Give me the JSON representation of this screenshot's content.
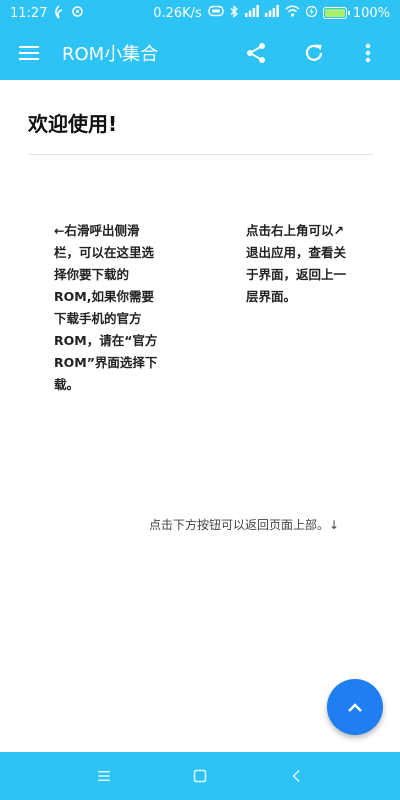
{
  "status_bar": {
    "time": "11:27",
    "network_speed": "0.26K/s",
    "battery_percent": "100%",
    "icons": [
      "app-notification-icon",
      "sync-icon",
      "messages-icon",
      "bluetooth-icon",
      "signal-icon",
      "signal-icon",
      "wifi-icon",
      "charging-icon",
      "battery-icon"
    ]
  },
  "app_bar": {
    "title": "ROM小集合",
    "icons": [
      "menu-icon",
      "share-icon",
      "refresh-icon",
      "more-vert-icon"
    ]
  },
  "content": {
    "welcome": "欢迎使用!",
    "tip_left": "←右滑呼出侧滑栏，可以在这里选择你要下载的ROM,如果你需要下载手机的官方ROM，请在“官方ROM”界面选择下载。",
    "tip_right": "点击右上角可以↗退出应用，查看关于界面，返回上一层界面。",
    "tip_bottom": "点击下方按钮可以返回页面上部。↓"
  },
  "fab": {
    "icon": "chevron-up-icon"
  },
  "nav_bar": {
    "icons": [
      "recent-apps-icon",
      "home-icon",
      "back-icon"
    ]
  },
  "colors": {
    "primary": "#2ec3f5",
    "fab": "#1f7ef2"
  }
}
